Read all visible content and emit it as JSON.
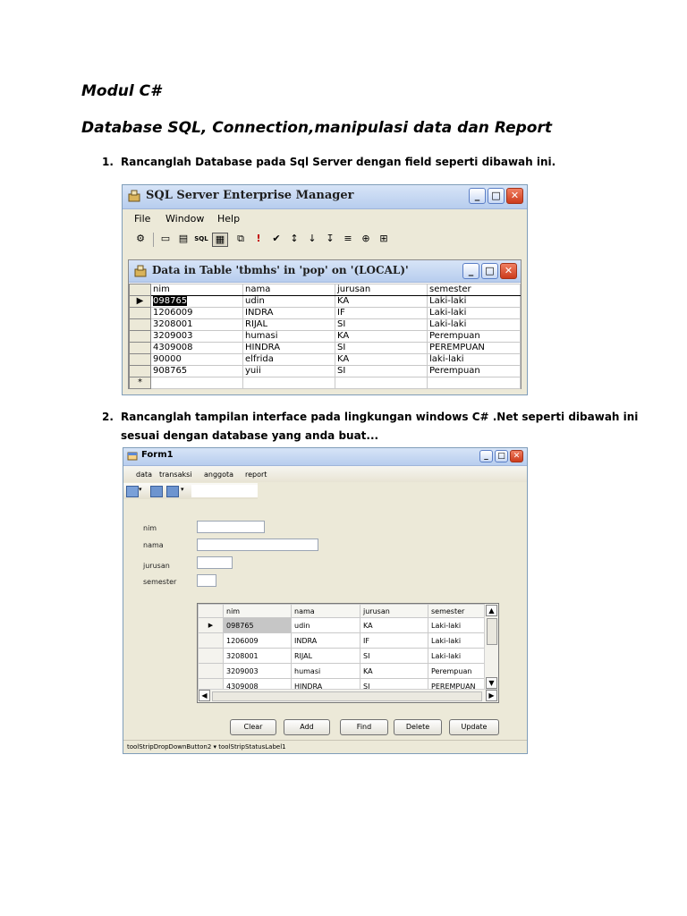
{
  "doc": {
    "title": "Modul  C#",
    "subtitle": "Database SQL, Connection,manipulasi data dan Report",
    "step1_num": "1.",
    "step1": "Rancanglah Database pada Sql Server dengan field seperti dibawah ini.",
    "step2_num": "2.",
    "step2_line1": "Rancanglah tampilan interface pada lingkungan windows C# .Net seperti dibawah ini",
    "step2_line2": "sesuai dengan database yang anda buat..."
  },
  "em": {
    "title": "SQL Server Enterprise Manager",
    "menu": [
      "File",
      "Window",
      "Help"
    ],
    "toolbar_icons": [
      "properties-icon",
      "show-diagram-pane-icon",
      "show-grid-pane-icon",
      "show-sql-pane-icon",
      "show-results-pane-icon",
      "change-query-type-icon",
      "run-icon",
      "verify-sql-icon",
      "sort-ascending-icon",
      "sort-descending-icon",
      "remove-filter-icon",
      "group-by-icon",
      "add-table-icon"
    ],
    "inner_title": "Data in Table 'tbmhs' in 'pop' on '(LOCAL)'",
    "columns": [
      "nim",
      "nama",
      "jurusan",
      "semester"
    ],
    "rows": [
      [
        "098765",
        "udin",
        "KA",
        "Laki-laki"
      ],
      [
        "1206009",
        "INDRA",
        "IF",
        "Laki-laki"
      ],
      [
        "3208001",
        "RIJAL",
        "SI",
        "Laki-laki"
      ],
      [
        "3209003",
        "humasi",
        "KA",
        "Perempuan"
      ],
      [
        "4309008",
        "HINDRA",
        "SI",
        "PEREMPUAN"
      ],
      [
        "90000",
        "elfrida",
        "KA",
        "laki-laki"
      ],
      [
        "908765",
        "yuii",
        "SI",
        "Perempuan"
      ]
    ],
    "new_row_marker": "*"
  },
  "form1": {
    "title": "Form1",
    "menu": [
      "data",
      "transaksi",
      "anggota",
      "report"
    ],
    "labels": {
      "nim": "nim",
      "nama": "nama",
      "jurusan": "jurusan",
      "semester": "semester"
    },
    "columns": [
      "nim",
      "nama",
      "jurusan",
      "semester"
    ],
    "rows": [
      [
        "098765",
        "udin",
        "KA",
        "Laki-laki"
      ],
      [
        "1206009",
        "INDRA",
        "IF",
        "Laki-laki"
      ],
      [
        "3208001",
        "RIJAL",
        "SI",
        "Laki-laki"
      ],
      [
        "3209003",
        "humasi",
        "KA",
        "Perempuan"
      ],
      [
        "4309008",
        "HINDRA",
        "SI",
        "PEREMPUAN"
      ]
    ],
    "buttons": {
      "clear": "Clear",
      "add": "Add",
      "find": "Find",
      "delete": "Delete",
      "update": "Update"
    },
    "status": "toolStripDropDownButton2 ▾ toolStripStatusLabel1"
  }
}
